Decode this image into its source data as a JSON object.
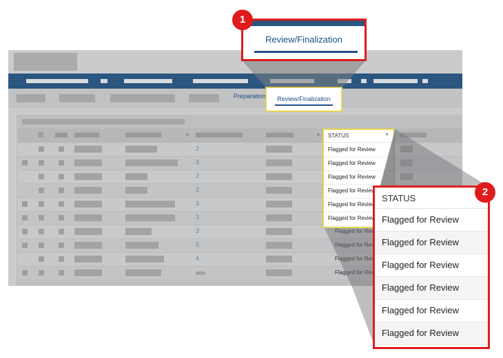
{
  "tabs": {
    "preparation_label": "Preparation",
    "review_finalization_label": "Review/Finalization"
  },
  "grid": {
    "status_header": "STATUS",
    "rows": [
      {
        "number": "2",
        "status": "Flagged for Review"
      },
      {
        "number": "3",
        "status": "Flagged for Review"
      },
      {
        "number": "2",
        "status": "Flagged for Review"
      },
      {
        "number": "2",
        "status": "Flagged for Review"
      },
      {
        "number": "3",
        "status": "Flagged for Review"
      },
      {
        "number": "3",
        "status": "Flagged for Review"
      },
      {
        "number": "3",
        "status": "Flagged for Review"
      },
      {
        "number": "5",
        "status": "Flagged for Review"
      },
      {
        "number": "4",
        "status": "Flagged for Review"
      },
      {
        "number": "",
        "status": "Flagged for Review"
      }
    ]
  },
  "callouts": {
    "one": {
      "badge": "1",
      "label": "Review/Finalization"
    },
    "two": {
      "badge": "2",
      "header": "STATUS",
      "rows": [
        "Flagged for Review",
        "Flagged for Review",
        "Flagged for Review",
        "Flagged for Review",
        "Flagged for Review",
        "Flagged for Review"
      ]
    }
  },
  "colors": {
    "accent_red": "#e01b1b",
    "nav_blue": "#2a567f",
    "highlight_yellow": "#e8d34f",
    "link_blue": "#1e4f86"
  }
}
